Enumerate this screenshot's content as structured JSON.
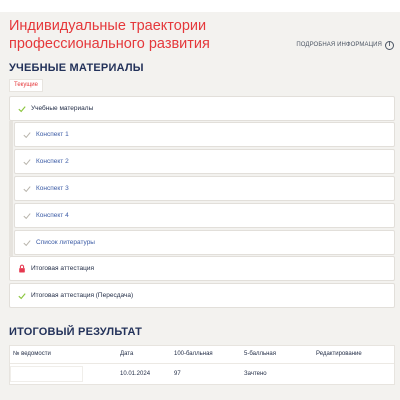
{
  "header": {
    "title": "Индивидуальные траектории профессионального развития",
    "more_info_label": "Подробная информация"
  },
  "materials": {
    "section_title": "Учебные материалы",
    "tab_label": "Текущие",
    "items": [
      {
        "label": "Учебные материалы",
        "icon": "check-icon"
      },
      {
        "label": "Конспект 1",
        "icon": "check-icon"
      },
      {
        "label": "Конспект 2",
        "icon": "check-icon"
      },
      {
        "label": "Конспект 3",
        "icon": "check-icon"
      },
      {
        "label": "Конспект 4",
        "icon": "check-icon"
      },
      {
        "label": "Список литературы",
        "icon": "check-icon"
      },
      {
        "label": "Итоговая аттестация",
        "icon": "lock-icon"
      },
      {
        "label": "Итоговая аттестация (Пересдача)",
        "icon": "check-icon"
      }
    ]
  },
  "result": {
    "section_title": "Итоговый результат",
    "columns": [
      "№ ведомости",
      "Дата",
      "100-балльная",
      "5-балльная",
      "Редактирование"
    ],
    "rows": [
      [
        "",
        "10.01.2024",
        "97",
        "Зачтено",
        ""
      ]
    ]
  },
  "colors": {
    "accent_red": "#e5383b",
    "heading_navy": "#23325a",
    "link_blue": "#3b5ba5",
    "check_green": "#8cc63f",
    "lock_red": "#e5384f",
    "page_bg": "#f3f2ef"
  }
}
